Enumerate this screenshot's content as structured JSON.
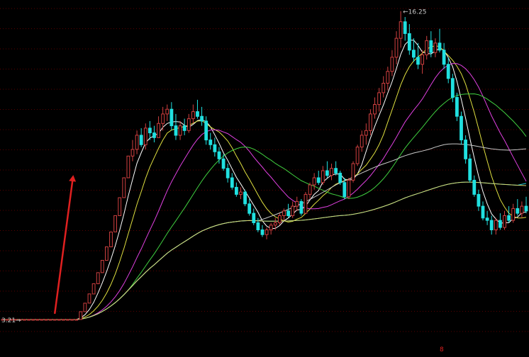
{
  "chart_data": {
    "type": "candlestick",
    "title": "",
    "xlabel": "",
    "ylabel": "",
    "grid": true,
    "grid_style": "dotted-horizontal",
    "ylim": [
      3.0,
      16.6
    ],
    "annotations": {
      "high_label": "16.25",
      "low_label": "3.21",
      "bottom_marker": "8"
    },
    "colors": {
      "background": "#000000",
      "up": "#d04040",
      "down": "#20e0e0",
      "grid": "#5a0000",
      "arrow": "#e02020"
    },
    "candles": [
      [
        3.21,
        3.22,
        3.2,
        3.21
      ],
      [
        3.21,
        3.22,
        3.2,
        3.21
      ],
      [
        3.21,
        3.22,
        3.2,
        3.21
      ],
      [
        3.21,
        3.22,
        3.2,
        3.21
      ],
      [
        3.21,
        3.22,
        3.2,
        3.21
      ],
      [
        3.21,
        3.22,
        3.2,
        3.21
      ],
      [
        3.21,
        3.22,
        3.2,
        3.21
      ],
      [
        3.21,
        3.22,
        3.2,
        3.21
      ],
      [
        3.21,
        3.22,
        3.2,
        3.21
      ],
      [
        3.21,
        3.22,
        3.2,
        3.21
      ],
      [
        3.21,
        3.22,
        3.2,
        3.21
      ],
      [
        3.21,
        3.22,
        3.2,
        3.21
      ],
      [
        3.21,
        3.22,
        3.2,
        3.21
      ],
      [
        3.21,
        3.22,
        3.2,
        3.21
      ],
      [
        3.21,
        3.22,
        3.2,
        3.21
      ],
      [
        3.21,
        3.22,
        3.2,
        3.21
      ],
      [
        3.21,
        3.22,
        3.2,
        3.21
      ],
      [
        3.21,
        3.22,
        3.2,
        3.21
      ],
      [
        3.21,
        3.54,
        3.21,
        3.54
      ],
      [
        3.54,
        3.9,
        3.54,
        3.9
      ],
      [
        3.9,
        4.29,
        3.9,
        4.29
      ],
      [
        4.29,
        4.72,
        4.29,
        4.72
      ],
      [
        4.72,
        5.19,
        4.72,
        5.19
      ],
      [
        5.19,
        5.71,
        5.19,
        5.71
      ],
      [
        5.71,
        6.28,
        5.71,
        6.28
      ],
      [
        6.28,
        6.91,
        6.28,
        6.91
      ],
      [
        6.91,
        7.6,
        6.91,
        7.6
      ],
      [
        7.6,
        8.36,
        7.6,
        8.36
      ],
      [
        8.36,
        9.2,
        8.36,
        9.2
      ],
      [
        9.2,
        10.12,
        9.2,
        10.12
      ],
      [
        10.12,
        10.8,
        9.9,
        10.4
      ],
      [
        10.4,
        11.2,
        10.2,
        11.0
      ],
      [
        11.0,
        11.3,
        10.5,
        10.6
      ],
      [
        10.6,
        11.5,
        10.4,
        11.3
      ],
      [
        11.3,
        11.6,
        10.8,
        11.1
      ],
      [
        11.1,
        11.4,
        10.7,
        10.9
      ],
      [
        10.9,
        11.8,
        10.9,
        11.5
      ],
      [
        11.5,
        12.2,
        11.2,
        11.9
      ],
      [
        11.9,
        12.3,
        11.6,
        12.1
      ],
      [
        12.1,
        12.4,
        11.2,
        11.4
      ],
      [
        11.4,
        11.9,
        10.8,
        11.0
      ],
      [
        11.0,
        11.6,
        10.8,
        11.4
      ],
      [
        11.4,
        11.7,
        11.0,
        11.2
      ],
      [
        11.2,
        11.9,
        11.1,
        11.7
      ],
      [
        11.7,
        12.3,
        11.5,
        12.0
      ],
      [
        12.0,
        12.5,
        11.7,
        11.8
      ],
      [
        11.8,
        12.2,
        11.4,
        11.6
      ],
      [
        11.6,
        11.8,
        10.6,
        10.8
      ],
      [
        10.8,
        11.1,
        10.4,
        10.6
      ],
      [
        10.6,
        10.9,
        10.1,
        10.3
      ],
      [
        10.3,
        10.5,
        9.8,
        10.0
      ],
      [
        10.0,
        10.2,
        9.5,
        9.6
      ],
      [
        9.6,
        9.8,
        9.0,
        9.2
      ],
      [
        9.2,
        9.4,
        8.7,
        8.8
      ],
      [
        8.8,
        9.0,
        8.4,
        8.5
      ],
      [
        8.5,
        8.8,
        8.3,
        8.6
      ],
      [
        8.6,
        8.7,
        8.0,
        8.1
      ],
      [
        8.1,
        8.3,
        7.6,
        7.7
      ],
      [
        7.7,
        7.9,
        7.2,
        7.3
      ],
      [
        7.3,
        7.5,
        6.9,
        7.0
      ],
      [
        7.0,
        7.2,
        6.7,
        6.8
      ],
      [
        6.8,
        7.1,
        6.6,
        7.0
      ],
      [
        7.0,
        7.3,
        6.8,
        7.2
      ],
      [
        7.2,
        7.5,
        7.0,
        7.3
      ],
      [
        7.3,
        7.7,
        7.2,
        7.6
      ],
      [
        7.6,
        7.9,
        7.4,
        7.8
      ],
      [
        7.8,
        8.1,
        7.5,
        7.6
      ],
      [
        7.6,
        8.2,
        7.5,
        8.0
      ],
      [
        8.0,
        8.4,
        7.8,
        8.2
      ],
      [
        8.2,
        8.3,
        7.6,
        7.7
      ],
      [
        7.7,
        8.6,
        7.7,
        8.5
      ],
      [
        8.5,
        9.0,
        8.3,
        8.9
      ],
      [
        8.9,
        9.4,
        8.7,
        9.2
      ],
      [
        9.2,
        9.5,
        8.9,
        9.0
      ],
      [
        9.0,
        9.7,
        8.9,
        9.5
      ],
      [
        9.5,
        9.9,
        9.2,
        9.3
      ],
      [
        9.3,
        9.8,
        9.1,
        9.6
      ],
      [
        9.6,
        9.9,
        9.3,
        9.4
      ],
      [
        9.4,
        9.5,
        8.9,
        9.0
      ],
      [
        9.0,
        9.2,
        8.3,
        8.4
      ],
      [
        8.4,
        9.2,
        8.3,
        9.1
      ],
      [
        9.1,
        9.9,
        9.0,
        9.8
      ],
      [
        9.8,
        10.6,
        9.7,
        10.5
      ],
      [
        10.5,
        11.2,
        10.3,
        11.0
      ],
      [
        11.0,
        11.5,
        10.6,
        11.2
      ],
      [
        11.2,
        12.1,
        11.0,
        11.9
      ],
      [
        11.9,
        12.6,
        11.7,
        12.3
      ],
      [
        12.3,
        13.0,
        12.0,
        12.8
      ],
      [
        12.8,
        13.5,
        12.6,
        13.2
      ],
      [
        13.2,
        13.9,
        12.9,
        13.7
      ],
      [
        13.7,
        14.6,
        13.5,
        14.3
      ],
      [
        14.3,
        15.4,
        14.0,
        15.1
      ],
      [
        15.1,
        16.25,
        14.7,
        15.8
      ],
      [
        15.8,
        16.0,
        15.0,
        15.3
      ],
      [
        15.3,
        15.7,
        14.4,
        14.6
      ],
      [
        14.6,
        15.1,
        14.1,
        14.3
      ],
      [
        14.3,
        14.9,
        13.8,
        14.0
      ],
      [
        14.0,
        14.6,
        13.6,
        14.4
      ],
      [
        14.4,
        15.2,
        14.2,
        15.0
      ],
      [
        15.0,
        15.4,
        14.3,
        14.5
      ],
      [
        14.5,
        15.1,
        14.3,
        14.9
      ],
      [
        14.9,
        15.5,
        14.5,
        14.6
      ],
      [
        14.6,
        14.9,
        13.8,
        14.0
      ],
      [
        14.0,
        14.3,
        13.2,
        13.4
      ],
      [
        13.4,
        13.6,
        12.4,
        12.6
      ],
      [
        12.6,
        12.8,
        11.6,
        11.8
      ],
      [
        11.8,
        12.0,
        10.6,
        10.8
      ],
      [
        10.8,
        11.0,
        9.8,
        10.0
      ],
      [
        10.0,
        10.2,
        9.0,
        9.1
      ],
      [
        9.1,
        9.3,
        8.4,
        8.5
      ],
      [
        8.5,
        8.7,
        7.8,
        8.0
      ],
      [
        8.0,
        8.2,
        7.4,
        7.5
      ],
      [
        7.5,
        7.8,
        7.2,
        7.4
      ],
      [
        7.4,
        7.6,
        6.8,
        7.0
      ],
      [
        7.0,
        7.5,
        6.8,
        7.4
      ],
      [
        7.4,
        7.7,
        7.0,
        7.1
      ],
      [
        7.1,
        7.8,
        7.0,
        7.6
      ],
      [
        7.6,
        8.0,
        7.3,
        7.4
      ],
      [
        7.4,
        8.1,
        7.3,
        7.9
      ],
      [
        7.9,
        8.3,
        7.6,
        7.7
      ],
      [
        7.7,
        8.2,
        7.5,
        8.0
      ],
      [
        8.0,
        8.4,
        7.7,
        7.8
      ]
    ],
    "moving_averages": [
      {
        "period": 5,
        "color": "#ffffff"
      },
      {
        "period": 10,
        "color": "#e0e040"
      },
      {
        "period": 20,
        "color": "#e040e0"
      },
      {
        "period": 30,
        "color": "#40d040"
      },
      {
        "period": 60,
        "color": "#c8c8c8"
      },
      {
        "period": 120,
        "color": "#20c8d8"
      },
      {
        "period": 250,
        "color": "#d8d870"
      }
    ]
  }
}
